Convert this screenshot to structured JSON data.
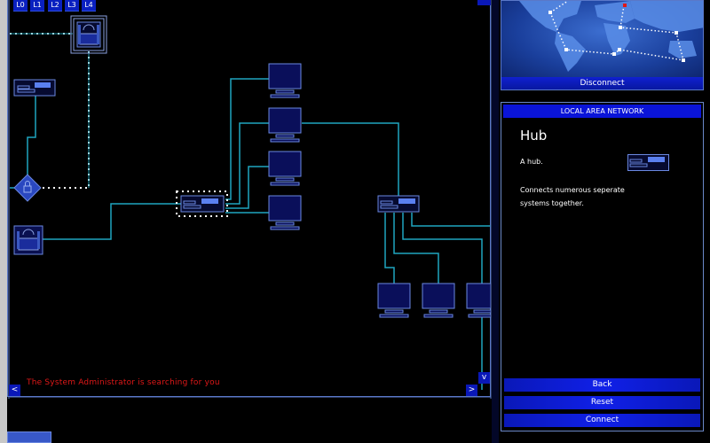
{
  "levels": [
    "L0",
    "L1",
    "L2",
    "L3",
    "L4"
  ],
  "status_message": "The System Administrator is searching for you",
  "scroll": {
    "left": "<",
    "right": ">",
    "down": "v"
  },
  "map_panel": {
    "disconnect_label": "Disconnect"
  },
  "info_panel": {
    "header": "LOCAL AREA NETWORK",
    "title": "Hub",
    "subtitle": "A hub.",
    "description": "Connects numerous seperate systems together."
  },
  "buttons": {
    "back": "Back",
    "reset": "Reset",
    "connect": "Connect"
  },
  "colors": {
    "link": "#1fa6c0",
    "node": "#6a88e0",
    "button": "#0a18b8",
    "alert": "#e01818"
  }
}
